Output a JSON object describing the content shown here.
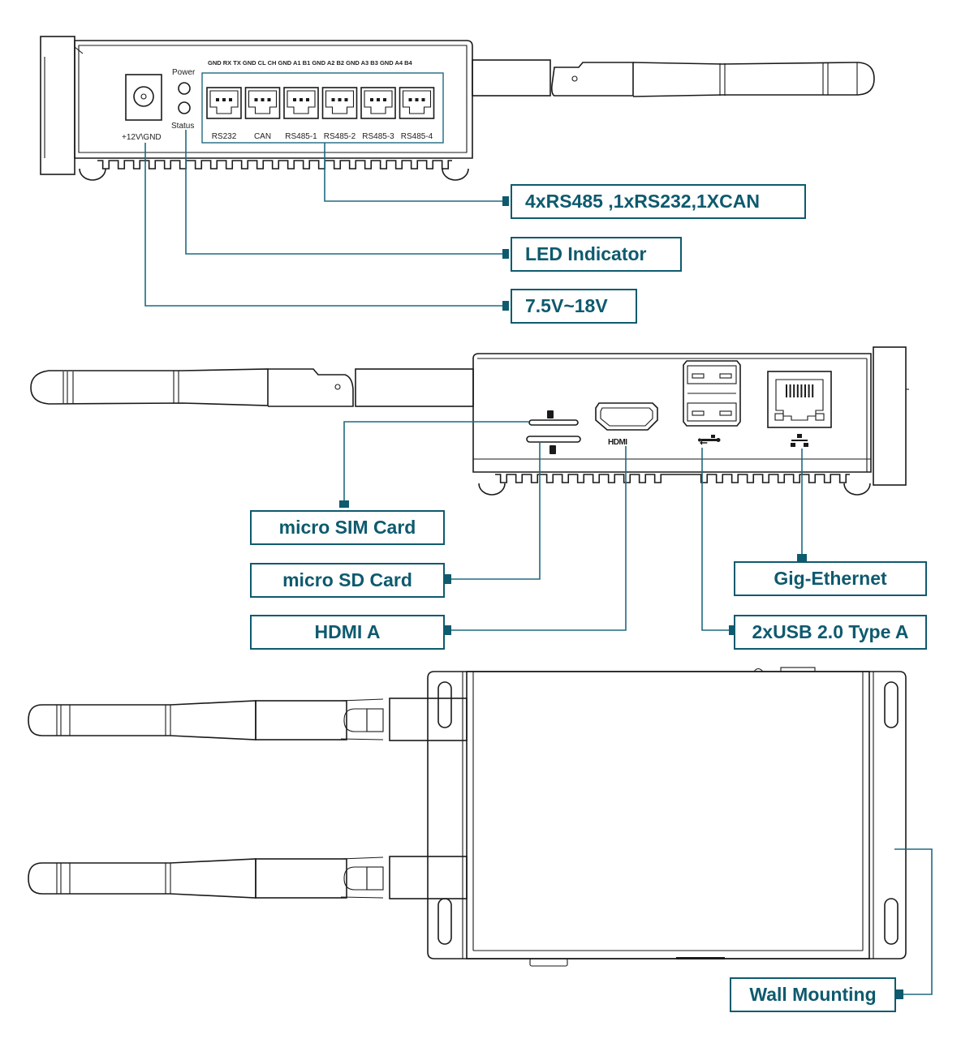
{
  "diagram": {
    "accent_color": "#0e5a6e",
    "top_view": {
      "pin_header": "GND RX TX  GND CL CH  GND A1 B1  GND A2 B2  GND A3 B3  GND A4 B4",
      "ports": [
        "RS232",
        "CAN",
        "RS485-1",
        "RS485-2",
        "RS485-3",
        "RS485-4"
      ],
      "power_jack_label": "+12V\\GND",
      "led_labels": {
        "power": "Power",
        "status": "Status"
      },
      "callouts": {
        "serial": "4xRS485 ,1xRS232,1XCAN",
        "led": "LED Indicator",
        "voltage": "7.5V~18V"
      }
    },
    "rear_view": {
      "port_icons": [
        "sim-slot-icon",
        "sd-slot-icon",
        "hdmi-port-icon",
        "usb-port-icon",
        "ethernet-port-icon"
      ],
      "hdmi_silkscreen": "HDMI",
      "callouts": {
        "sim": "micro SIM Card",
        "sd": "micro SD Card",
        "hdmi": "HDMI A",
        "ethernet": "Gig-Ethernet",
        "usb": "2xUSB 2.0 Type A"
      }
    },
    "bottom_view": {
      "callouts": {
        "mount": "Wall Mounting"
      }
    }
  }
}
